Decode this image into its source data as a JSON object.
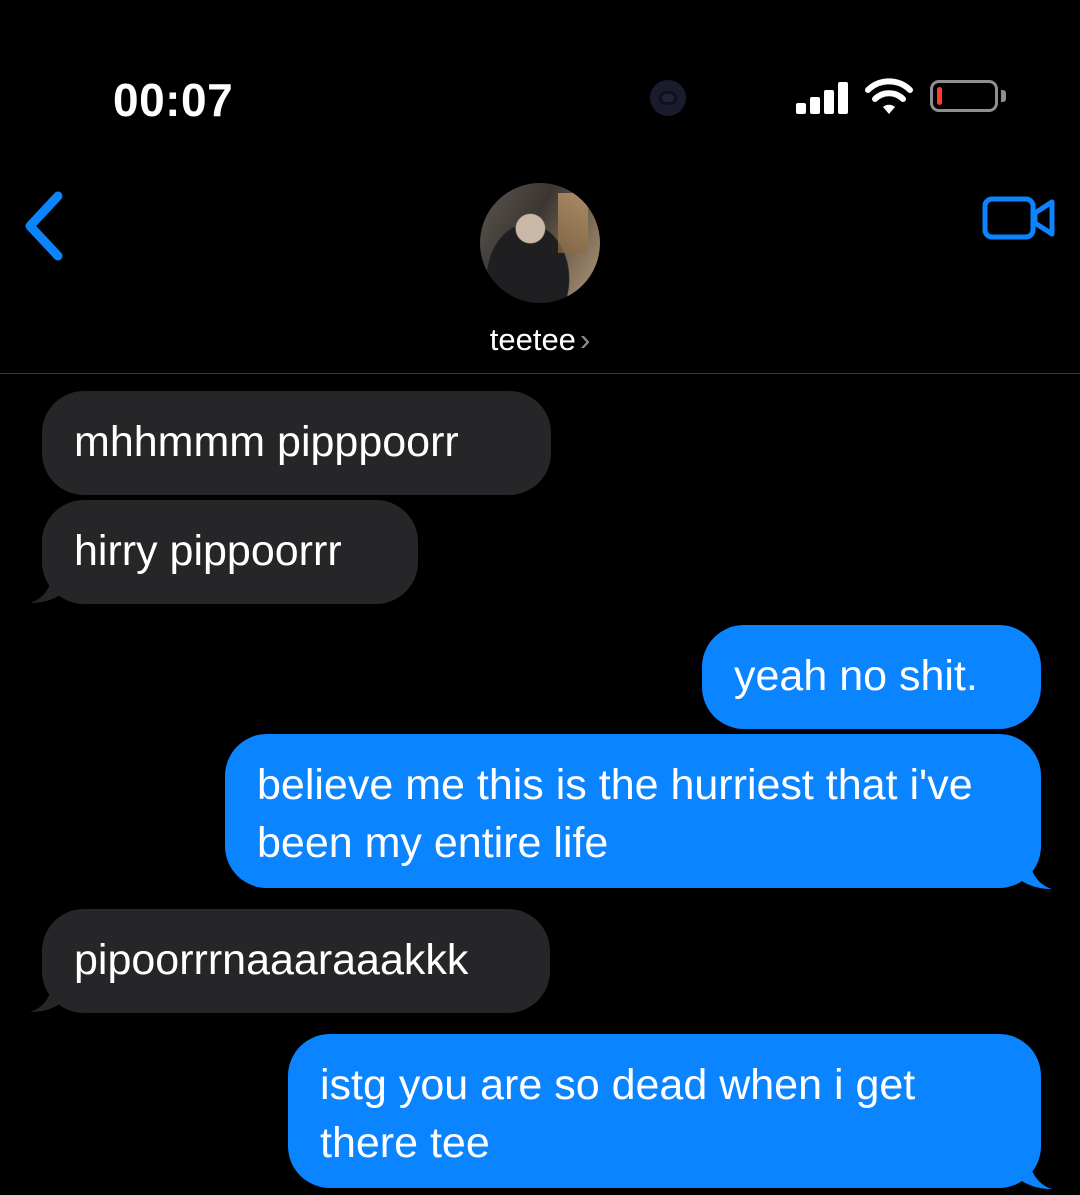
{
  "status_bar": {
    "time": "00:07",
    "icons": [
      "focus-icon",
      "cellular-signal-icon",
      "wifi-icon",
      "battery-icon"
    ],
    "battery_level": 0.1,
    "battery_color": "#ff3b30"
  },
  "header": {
    "back_icon": "chevron-left-icon",
    "contact_name": "teetee",
    "contact_chevron": "›",
    "video_icon": "video-camera-icon",
    "accent": "#0a84ff"
  },
  "messages": [
    {
      "direction": "incoming",
      "text": "mhhmmm pipppoorr"
    },
    {
      "direction": "incoming",
      "text": "hirry pippoorrr"
    },
    {
      "direction": "outgoing",
      "text": "yeah no shit."
    },
    {
      "direction": "outgoing",
      "text": "believe me this is the hurriest that i've been my entire life"
    },
    {
      "direction": "incoming",
      "text": "pipoorrrnaaaraaakkk"
    },
    {
      "direction": "outgoing",
      "text": "istg you are so dead when i get there tee"
    }
  ],
  "colors": {
    "incoming_bubble": "#262628",
    "outgoing_bubble": "#0a84ff",
    "background": "#000000"
  }
}
